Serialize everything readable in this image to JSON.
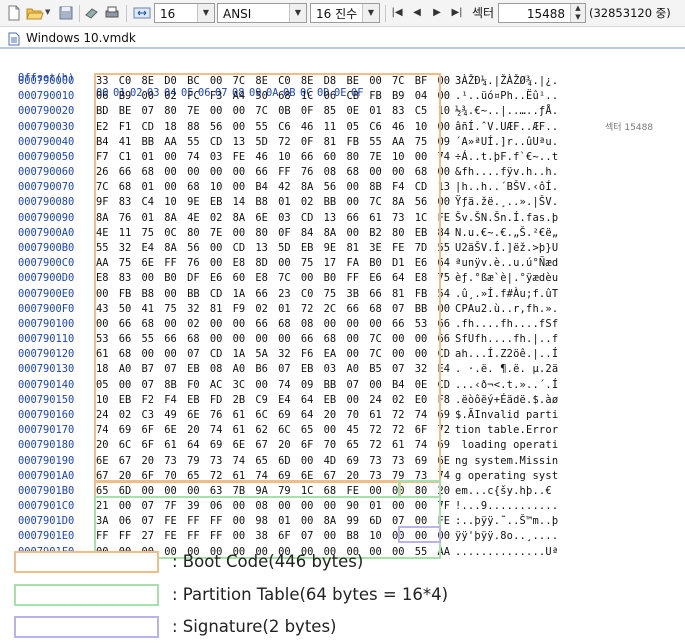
{
  "toolbar": {
    "bytes_per_row": "16",
    "charset": "ANSI",
    "radix": "16 진수",
    "sector_label": "섹터",
    "sector_value": "15488",
    "sector_total": "(32853120 중)"
  },
  "tab": {
    "title": "Windows 10.vmdk"
  },
  "hex": {
    "header_label": "Offset(h)",
    "columns": [
      "00",
      "01",
      "02",
      "03",
      "04",
      "05",
      "06",
      "07",
      "08",
      "09",
      "0A",
      "0B",
      "0C",
      "0D",
      "0E",
      "0F"
    ],
    "sector_note": "섹터 15488",
    "rows": [
      {
        "addr": "000790000",
        "bytes": "33 C0 8E D0 BC 00 7C 8E C0 8E D8 BE 00 7C BF 00",
        "ascii": "3ÀŽÐ¼.|ŽÀŽØ¾.|¿."
      },
      {
        "addr": "000790010",
        "bytes": "06 B9 00 02 FC F3 A4 50 68 1C 06 CB FB B9 04 00",
        "ascii": ".¹..üó¤Ph..Ëû¹.."
      },
      {
        "addr": "000790020",
        "bytes": "BD BE 07 80 7E 00 00 7C 0B 0F 85 0E 01 83 C5 10",
        "ascii": "½¾.€~..|..…..ƒÅ."
      },
      {
        "addr": "000790030",
        "bytes": "E2 F1 CD 18 88 56 00 55 C6 46 11 05 C6 46 10 00",
        "ascii": "âñÍ.ˆV.UÆF..ÆF.."
      },
      {
        "addr": "000790040",
        "bytes": "B4 41 BB AA 55 CD 13 5D 72 0F 81 FB 55 AA 75 09",
        "ascii": "´A»ªUÍ.]r..ûUªu."
      },
      {
        "addr": "000790050",
        "bytes": "F7 C1 01 00 74 03 FE 46 10 66 60 80 7E 10 00 74",
        "ascii": "÷Á..t.þF.f`€~..t"
      },
      {
        "addr": "000790060",
        "bytes": "26 66 68 00 00 00 00 66 FF 76 08 68 00 00 68 00",
        "ascii": "&fh....fÿv.h..h."
      },
      {
        "addr": "000790070",
        "bytes": "7C 68 01 00 68 10 00 B4 42 8A 56 00 8B F4 CD 13",
        "ascii": "|h..h..´BŠV.‹ôÍ."
      },
      {
        "addr": "000790080",
        "bytes": "9F 83 C4 10 9E EB 14 B8 01 02 BB 00 7C 8A 56 00",
        "ascii": "Ÿƒä.žë.¸..».|ŠV."
      },
      {
        "addr": "000790090",
        "bytes": "8A 76 01 8A 4E 02 8A 6E 03 CD 13 66 61 73 1C FE",
        "ascii": "Šv.ŠN.Šn.Í.fas.þ"
      },
      {
        "addr": "0007900A0",
        "bytes": "4E 11 75 0C 80 7E 00 80 0F 84 8A 00 B2 80 EB 84",
        "ascii": "N.u.€~.€.„Š.²€ë„"
      },
      {
        "addr": "0007900B0",
        "bytes": "55 32 E4 8A 56 00 CD 13 5D EB 9E 81 3E FE 7D 55",
        "ascii": "U2äŠV.Í.]ëž.>þ}U"
      },
      {
        "addr": "0007900C0",
        "bytes": "AA 75 6E FF 76 00 E8 8D 00 75 17 FA B0 D1 E6 64",
        "ascii": "ªunÿv.è..u.ú°Ñæd"
      },
      {
        "addr": "0007900D0",
        "bytes": "E8 83 00 B0 DF E6 60 E8 7C 00 B0 FF E6 64 E8 75",
        "ascii": "èƒ.°ßæ`è|.°ÿædèu"
      },
      {
        "addr": "0007900E0",
        "bytes": "00 FB B8 00 BB CD 1A 66 23 C0 75 3B 66 81 FB 54",
        "ascii": ".û¸.»Í.f#Àu;f.ûT"
      },
      {
        "addr": "0007900F0",
        "bytes": "43 50 41 75 32 81 F9 02 01 72 2C 66 68 07 BB 00",
        "ascii": "CPAu2.ù..r,fh.»."
      },
      {
        "addr": "000790100",
        "bytes": "00 66 68 00 02 00 00 66 68 08 00 00 00 66 53 66",
        "ascii": ".fh....fh....fSf"
      },
      {
        "addr": "000790110",
        "bytes": "53 66 55 66 68 00 00 00 00 66 68 00 7C 00 00 66",
        "ascii": "SfUfh....fh.|..f"
      },
      {
        "addr": "000790120",
        "bytes": "61 68 00 00 07 CD 1A 5A 32 F6 EA 00 7C 00 00 CD",
        "ascii": "ah...Í.Z2öê.|..Í"
      },
      {
        "addr": "000790130",
        "bytes": "18 A0 B7 07 EB 08 A0 B6 07 EB 03 A0 B5 07 32 E4",
        "ascii": ". ·.ë. ¶.ë. µ.2ä"
      },
      {
        "addr": "000790140",
        "bytes": "05 00 07 8B F0 AC 3C 00 74 09 BB 07 00 B4 0E CD",
        "ascii": "...‹ð¬<.t.»..´.Í"
      },
      {
        "addr": "000790150",
        "bytes": "10 EB F2 F4 EB FD 2B C9 E4 64 EB 00 24 02 E0 F8",
        "ascii": ".ëòôëý+Éädë.$.àø"
      },
      {
        "addr": "000790160",
        "bytes": "24 02 C3 49 6E 76 61 6C 69 64 20 70 61 72 74 69",
        "ascii": "$.ÃInvalid parti"
      },
      {
        "addr": "000790170",
        "bytes": "74 69 6F 6E 20 74 61 62 6C 65 00 45 72 72 6F 72",
        "ascii": "tion table.Error"
      },
      {
        "addr": "000790180",
        "bytes": "20 6C 6F 61 64 69 6E 67 20 6F 70 65 72 61 74 69",
        "ascii": " loading operati"
      },
      {
        "addr": "000790190",
        "bytes": "6E 67 20 73 79 73 74 65 6D 00 4D 69 73 73 69 6E",
        "ascii": "ng system.Missin"
      },
      {
        "addr": "0007901A0",
        "bytes": "67 20 6F 70 65 72 61 74 69 6E 67 20 73 79 73 74",
        "ascii": "g operating syst"
      },
      {
        "addr": "0007901B0",
        "bytes": "65 6D 00 00 00 63 7B 9A 79 1C 68 FE 00 00 80 20",
        "ascii": "em...c{šy.hþ..€ "
      },
      {
        "addr": "0007901C0",
        "bytes": "21 00 07 7F 39 06 00 08 00 00 00 90 01 00 00 7F",
        "ascii": "!...9..........."
      },
      {
        "addr": "0007901D0",
        "bytes": "3A 06 07 FE FF FF 00 98 01 00 8A 99 6D 07 00 FE",
        "ascii": ":..þÿÿ.˜..Š™m..þ"
      },
      {
        "addr": "0007901E0",
        "bytes": "FF FF 27 FE FF FF 00 38 6F 07 00 B8 10 00 00 00",
        "ascii": "ÿÿ'þÿÿ.8o..¸...."
      },
      {
        "addr": "0007901F0",
        "bytes": "00 00 00 00 00 00 00 00 00 00 00 00 00 00 55 AA",
        "ascii": "..............Uª"
      }
    ]
  },
  "legend": [
    {
      "label": ": Boot Code(446 bytes)",
      "color": "#f2be88"
    },
    {
      "label": ": Partition Table(64 bytes = 16*4)",
      "color": "#a8e0ac"
    },
    {
      "label": ": Signature(2 bytes)",
      "color": "#b8b4ea"
    }
  ],
  "icons": [
    "new-file-icon",
    "open-folder-icon",
    "save-icon",
    "copy-icon",
    "print-icon",
    "columns-icon",
    "first-icon",
    "prev-icon",
    "next-icon",
    "last-icon",
    "document-icon"
  ]
}
